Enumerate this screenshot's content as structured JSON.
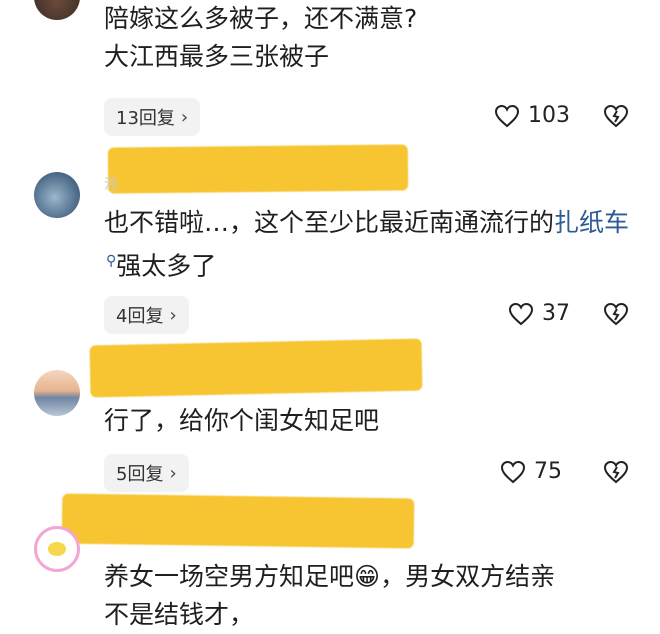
{
  "comments": [
    {
      "id": "c1",
      "lines": [
        "陪嫁这么多被子，还不满意?",
        "大江西最多三张被子"
      ],
      "replies": "13回复",
      "likes": "103"
    },
    {
      "id": "c2",
      "text_pre": "也不错啦…，这个至少比最近南通流行的",
      "link_text": "扎纸车",
      "text_post": "强太多了",
      "replies": "4回复",
      "likes": "37"
    },
    {
      "id": "c3",
      "lines": [
        "行了，给你个闺女知足吧"
      ],
      "replies": "5回复",
      "likes": "75"
    },
    {
      "id": "c4",
      "line1_pre": "养女一场空男方知足吧",
      "line1_emoji": "😁",
      "line1_post": "，男女双方结亲",
      "line2": "不是结钱才，"
    }
  ],
  "colors": {
    "redaction": "#f7c531",
    "link": "#2e5b96",
    "pill": "#f2f2f2"
  },
  "icons": {
    "like": "heart-outline-icon",
    "dislike": "broken-heart-icon",
    "chevron": "chevron-right-icon"
  }
}
